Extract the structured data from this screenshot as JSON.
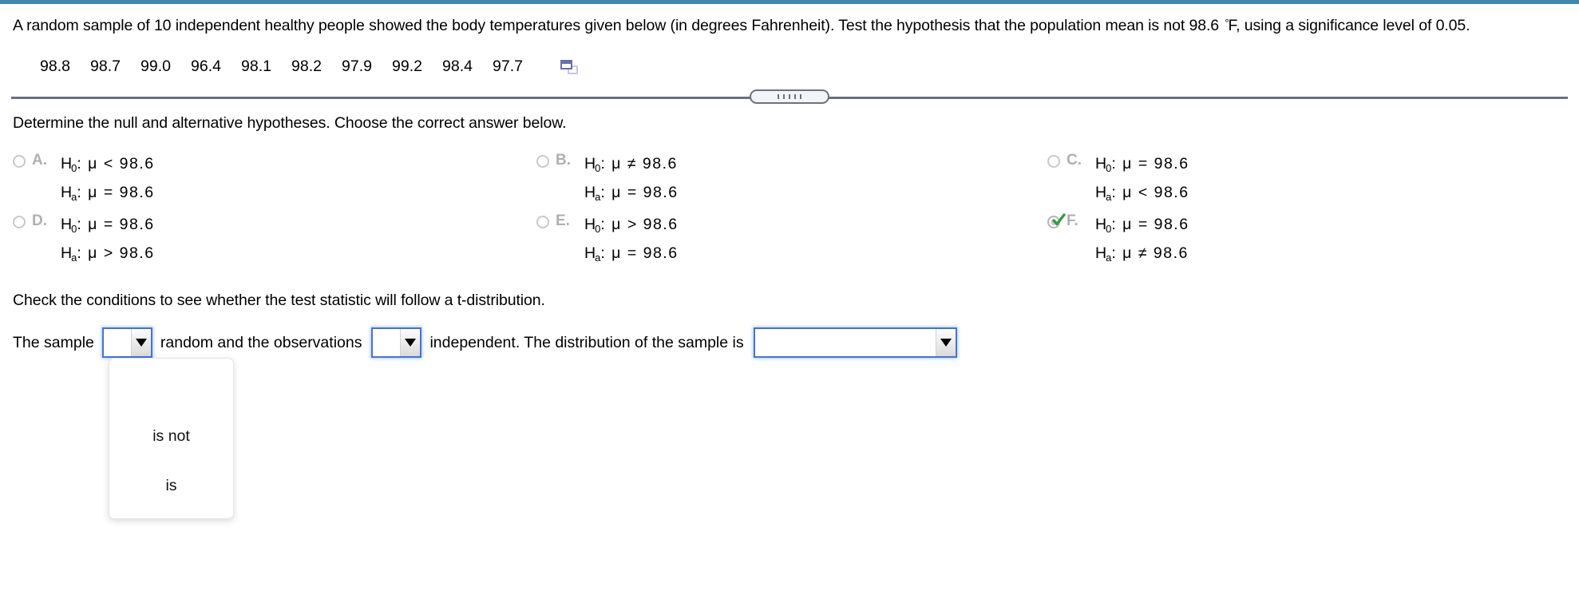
{
  "theme": {
    "accent_bar": "#3f86ab",
    "splitter": "#69727e",
    "combo_border": "#4573d3",
    "option_letter": "#b0b0b0",
    "check_green": "#2e9e3e",
    "copy_icon_front": "#6670ae",
    "copy_icon_back": "#c3c8e6"
  },
  "question": {
    "stem_part1": "A random sample of 10 independent healthy people showed the body temperatures given below (in degrees Fahrenheit). Test the hypothesis that the population mean is not 98.6 ",
    "degree_symbol": "°",
    "stem_part2": "F, using a significance level of 0.05.",
    "data_values": [
      "98.8",
      "98.7",
      "99.0",
      "96.4",
      "98.1",
      "98.2",
      "97.9",
      "99.2",
      "98.4",
      "97.7"
    ],
    "copy_icon": "copy-icon"
  },
  "splitter": {
    "dots": 5,
    "handle_name": "splitter-handle"
  },
  "prompts": {
    "hypotheses": "Determine the null and alternative hypotheses. Choose the correct answer below.",
    "conditions": "Check the conditions to see whether the test statistic will follow a t-distribution."
  },
  "options": [
    {
      "id": "A",
      "letter": "A.",
      "selected": false,
      "null_label": "H",
      "null_sub": "0",
      "null_rest": ": μ < 98.6",
      "alt_label": "H",
      "alt_sub": "a",
      "alt_rest": ": μ = 98.6"
    },
    {
      "id": "B",
      "letter": "B.",
      "selected": false,
      "null_label": "H",
      "null_sub": "0",
      "null_rest": ": μ ≠ 98.6",
      "alt_label": "H",
      "alt_sub": "a",
      "alt_rest": ": μ = 98.6"
    },
    {
      "id": "C",
      "letter": "C.",
      "selected": false,
      "null_label": "H",
      "null_sub": "0",
      "null_rest": ": μ = 98.6",
      "alt_label": "H",
      "alt_sub": "a",
      "alt_rest": ": μ < 98.6"
    },
    {
      "id": "D",
      "letter": "D.",
      "selected": false,
      "null_label": "H",
      "null_sub": "0",
      "null_rest": ": μ = 98.6",
      "alt_label": "H",
      "alt_sub": "a",
      "alt_rest": ": μ > 98.6"
    },
    {
      "id": "E",
      "letter": "E.",
      "selected": false,
      "null_label": "H",
      "null_sub": "0",
      "null_rest": ": μ > 98.6",
      "alt_label": "H",
      "alt_sub": "a",
      "alt_rest": ": μ = 98.6"
    },
    {
      "id": "F",
      "letter": "F.",
      "selected": true,
      "null_label": "H",
      "null_sub": "0",
      "null_rest": ": μ = 98.6",
      "alt_label": "H",
      "alt_sub": "a",
      "alt_rest": ": μ ≠ 98.6"
    }
  ],
  "conditions_sentence": {
    "text_1": "The sample",
    "text_2": "random and the observations",
    "text_3": "independent. The distribution of the sample is",
    "combo_random": {
      "value": "",
      "arrow": "chevron-down-icon"
    },
    "combo_independent": {
      "value": "",
      "arrow": "chevron-down-icon"
    },
    "combo_distribution": {
      "value": "",
      "arrow": "chevron-down-icon"
    }
  },
  "dropdown_list": {
    "open_for": "combo-random",
    "options": [
      "",
      "is not",
      "is"
    ]
  }
}
